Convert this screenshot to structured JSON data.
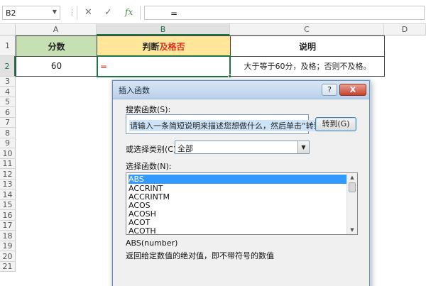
{
  "formula_bar": {
    "name_box": "B2",
    "name_box_arrow": "▼",
    "separator": "⋮",
    "cancel_icon": "✕",
    "confirm_icon": "✓",
    "fx_label": "fx",
    "formula": "="
  },
  "columns": [
    "A",
    "B",
    "C",
    "D"
  ],
  "rows": [
    "1",
    "2",
    "3",
    "4",
    "5",
    "6",
    "7",
    "8",
    "9",
    "10",
    "11",
    "12",
    "13",
    "14",
    "15",
    "16",
    "17",
    "18",
    "19",
    "20",
    "21"
  ],
  "sheet": {
    "a1": "分数",
    "b1_part1": "判断",
    "b1_part2": "及格否",
    "c1": "说明",
    "a2": "60",
    "b2": "=",
    "c2": "大于等于60分，及格；否则不及格。"
  },
  "colors": {
    "header_green": "#c6e0b4",
    "header_yellow": "#ffe699",
    "accent_red": "#e03020",
    "selection_green": "#217346",
    "list_selection": "#3399ff"
  },
  "dialog": {
    "title": "插入函数",
    "help_label": "?",
    "close_label": "X",
    "search_label": "搜索函数(S):",
    "search_value": "请输入一条简短说明来描述您想做什么，然后单击“转到”",
    "goto_label": "转到(G)",
    "category_label": "或选择类别(C):",
    "category_value": "全部",
    "category_arrow": "▼",
    "list_label": "选择函数(N):",
    "functions": [
      "ABS",
      "ACCRINT",
      "ACCRINTM",
      "ACOS",
      "ACOSH",
      "ACOT",
      "ACOTH"
    ],
    "selected_function": "ABS",
    "scroll_up": "▲",
    "scroll_down": "▼",
    "syntax": "ABS(number)",
    "description": "返回给定数值的绝对值，即不带符号的数值"
  }
}
